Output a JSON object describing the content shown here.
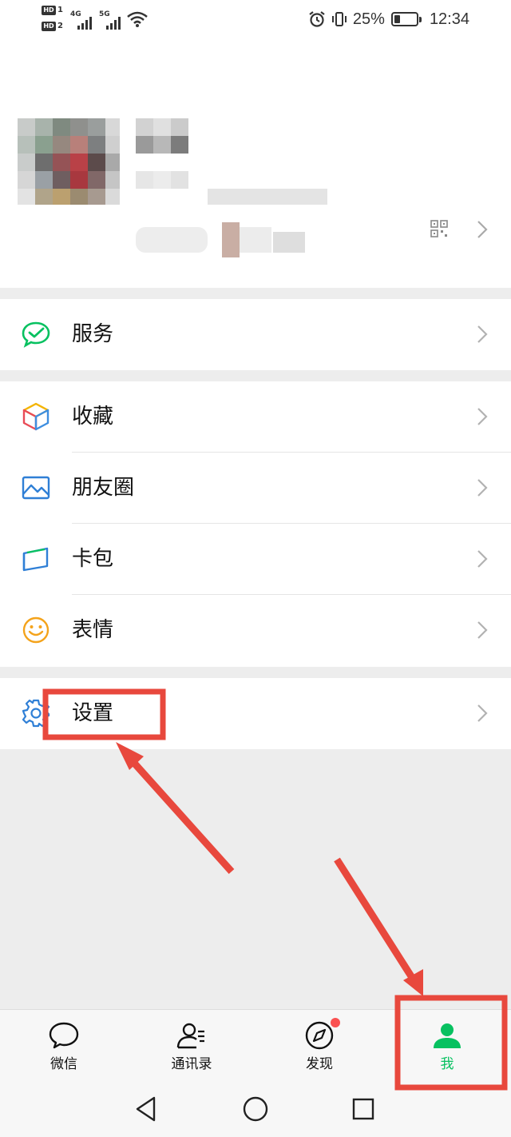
{
  "status_bar": {
    "sim1_tag": "HD",
    "sim1_slot": "1",
    "sim2_tag": "HD",
    "sim2_slot": "2",
    "network1": "4G",
    "network2": "5G",
    "battery_percent_text": "25%",
    "battery_level": 0.25,
    "time": "12:34",
    "icons": [
      "alarm-icon",
      "vibrate-icon",
      "battery-icon",
      "wifi-icon"
    ]
  },
  "profile": {
    "icons": [
      "qr-code-icon",
      "chevron-right-icon"
    ],
    "note": ""
  },
  "menu_groups": [
    {
      "items": [
        {
          "label": "服务",
          "icon": "wechat-pay-icon"
        }
      ]
    },
    {
      "items": [
        {
          "label": "收藏",
          "icon": "favorites-cube-icon"
        },
        {
          "label": "朋友圈",
          "icon": "moments-picture-icon"
        },
        {
          "label": "卡包",
          "icon": "card-wallet-icon"
        },
        {
          "label": "表情",
          "icon": "sticker-smile-icon"
        }
      ]
    },
    {
      "items": [
        {
          "label": "设置",
          "icon": "settings-gear-icon"
        }
      ]
    }
  ],
  "tabbar": {
    "tabs": [
      {
        "label": "微信",
        "icon": "chat-bubble-icon",
        "active": false
      },
      {
        "label": "通讯录",
        "icon": "contacts-icon",
        "active": false
      },
      {
        "label": "发现",
        "icon": "compass-icon",
        "active": false,
        "badge_dot": true
      },
      {
        "label": "我",
        "icon": "person-icon",
        "active": true
      }
    ]
  },
  "system_nav": {
    "buttons": [
      "back-triangle-icon",
      "home-circle-icon",
      "recents-square-icon"
    ]
  },
  "colors": {
    "accent_green": "#07c160",
    "annotation_red": "#e8483d",
    "badge_red": "#fa5151",
    "background": "#ededed"
  }
}
